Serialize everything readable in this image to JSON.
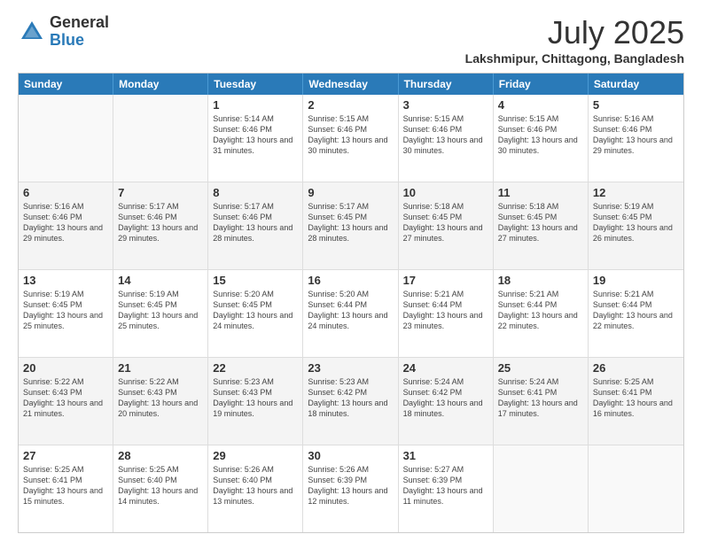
{
  "header": {
    "logo_general": "General",
    "logo_blue": "Blue",
    "month": "July 2025",
    "location": "Lakshmipur, Chittagong, Bangladesh"
  },
  "days_of_week": [
    "Sunday",
    "Monday",
    "Tuesday",
    "Wednesday",
    "Thursday",
    "Friday",
    "Saturday"
  ],
  "weeks": [
    [
      {
        "day": "",
        "info": ""
      },
      {
        "day": "",
        "info": ""
      },
      {
        "day": "1",
        "info": "Sunrise: 5:14 AM\nSunset: 6:46 PM\nDaylight: 13 hours and 31 minutes."
      },
      {
        "day": "2",
        "info": "Sunrise: 5:15 AM\nSunset: 6:46 PM\nDaylight: 13 hours and 30 minutes."
      },
      {
        "day": "3",
        "info": "Sunrise: 5:15 AM\nSunset: 6:46 PM\nDaylight: 13 hours and 30 minutes."
      },
      {
        "day": "4",
        "info": "Sunrise: 5:15 AM\nSunset: 6:46 PM\nDaylight: 13 hours and 30 minutes."
      },
      {
        "day": "5",
        "info": "Sunrise: 5:16 AM\nSunset: 6:46 PM\nDaylight: 13 hours and 29 minutes."
      }
    ],
    [
      {
        "day": "6",
        "info": "Sunrise: 5:16 AM\nSunset: 6:46 PM\nDaylight: 13 hours and 29 minutes."
      },
      {
        "day": "7",
        "info": "Sunrise: 5:17 AM\nSunset: 6:46 PM\nDaylight: 13 hours and 29 minutes."
      },
      {
        "day": "8",
        "info": "Sunrise: 5:17 AM\nSunset: 6:46 PM\nDaylight: 13 hours and 28 minutes."
      },
      {
        "day": "9",
        "info": "Sunrise: 5:17 AM\nSunset: 6:45 PM\nDaylight: 13 hours and 28 minutes."
      },
      {
        "day": "10",
        "info": "Sunrise: 5:18 AM\nSunset: 6:45 PM\nDaylight: 13 hours and 27 minutes."
      },
      {
        "day": "11",
        "info": "Sunrise: 5:18 AM\nSunset: 6:45 PM\nDaylight: 13 hours and 27 minutes."
      },
      {
        "day": "12",
        "info": "Sunrise: 5:19 AM\nSunset: 6:45 PM\nDaylight: 13 hours and 26 minutes."
      }
    ],
    [
      {
        "day": "13",
        "info": "Sunrise: 5:19 AM\nSunset: 6:45 PM\nDaylight: 13 hours and 25 minutes."
      },
      {
        "day": "14",
        "info": "Sunrise: 5:19 AM\nSunset: 6:45 PM\nDaylight: 13 hours and 25 minutes."
      },
      {
        "day": "15",
        "info": "Sunrise: 5:20 AM\nSunset: 6:45 PM\nDaylight: 13 hours and 24 minutes."
      },
      {
        "day": "16",
        "info": "Sunrise: 5:20 AM\nSunset: 6:44 PM\nDaylight: 13 hours and 24 minutes."
      },
      {
        "day": "17",
        "info": "Sunrise: 5:21 AM\nSunset: 6:44 PM\nDaylight: 13 hours and 23 minutes."
      },
      {
        "day": "18",
        "info": "Sunrise: 5:21 AM\nSunset: 6:44 PM\nDaylight: 13 hours and 22 minutes."
      },
      {
        "day": "19",
        "info": "Sunrise: 5:21 AM\nSunset: 6:44 PM\nDaylight: 13 hours and 22 minutes."
      }
    ],
    [
      {
        "day": "20",
        "info": "Sunrise: 5:22 AM\nSunset: 6:43 PM\nDaylight: 13 hours and 21 minutes."
      },
      {
        "day": "21",
        "info": "Sunrise: 5:22 AM\nSunset: 6:43 PM\nDaylight: 13 hours and 20 minutes."
      },
      {
        "day": "22",
        "info": "Sunrise: 5:23 AM\nSunset: 6:43 PM\nDaylight: 13 hours and 19 minutes."
      },
      {
        "day": "23",
        "info": "Sunrise: 5:23 AM\nSunset: 6:42 PM\nDaylight: 13 hours and 18 minutes."
      },
      {
        "day": "24",
        "info": "Sunrise: 5:24 AM\nSunset: 6:42 PM\nDaylight: 13 hours and 18 minutes."
      },
      {
        "day": "25",
        "info": "Sunrise: 5:24 AM\nSunset: 6:41 PM\nDaylight: 13 hours and 17 minutes."
      },
      {
        "day": "26",
        "info": "Sunrise: 5:25 AM\nSunset: 6:41 PM\nDaylight: 13 hours and 16 minutes."
      }
    ],
    [
      {
        "day": "27",
        "info": "Sunrise: 5:25 AM\nSunset: 6:41 PM\nDaylight: 13 hours and 15 minutes."
      },
      {
        "day": "28",
        "info": "Sunrise: 5:25 AM\nSunset: 6:40 PM\nDaylight: 13 hours and 14 minutes."
      },
      {
        "day": "29",
        "info": "Sunrise: 5:26 AM\nSunset: 6:40 PM\nDaylight: 13 hours and 13 minutes."
      },
      {
        "day": "30",
        "info": "Sunrise: 5:26 AM\nSunset: 6:39 PM\nDaylight: 13 hours and 12 minutes."
      },
      {
        "day": "31",
        "info": "Sunrise: 5:27 AM\nSunset: 6:39 PM\nDaylight: 13 hours and 11 minutes."
      },
      {
        "day": "",
        "info": ""
      },
      {
        "day": "",
        "info": ""
      }
    ]
  ]
}
